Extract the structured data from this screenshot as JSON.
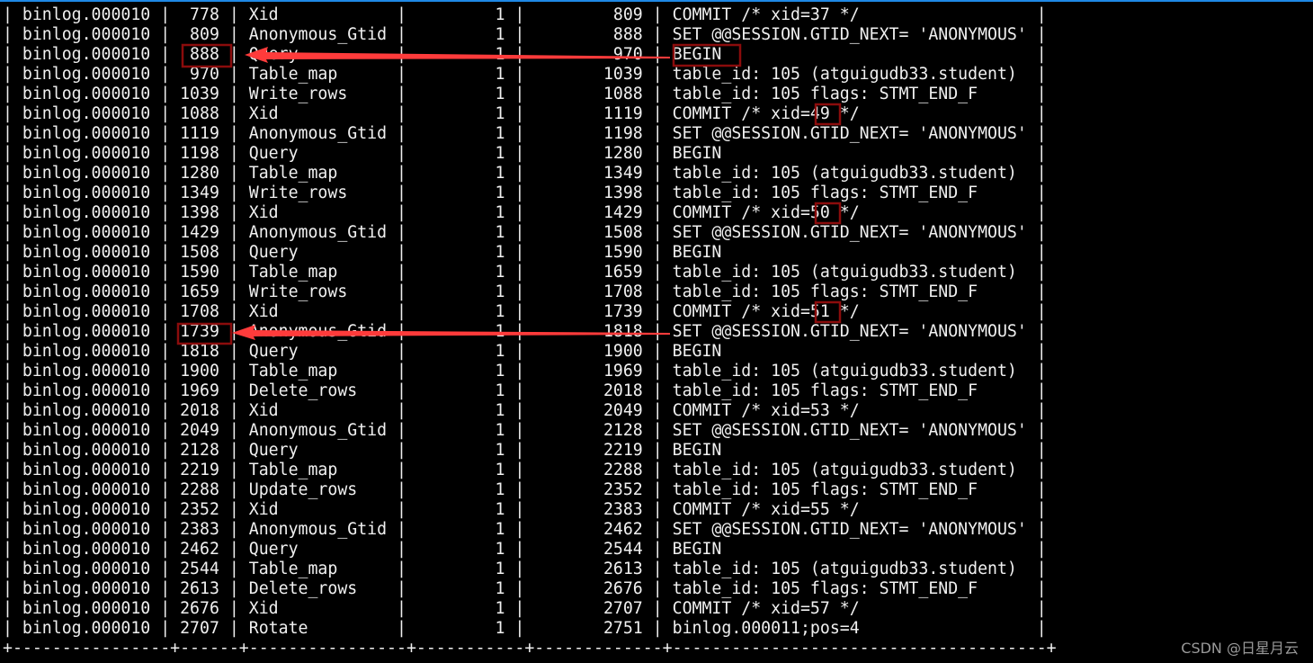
{
  "colors": {
    "accent_bar": "#1e88e5",
    "text": "#f0f0f0",
    "arrow": "#ff3b3b",
    "box": "#8b0c0c"
  },
  "rows": [
    [
      "binlog.000010",
      "778",
      "Xid",
      "1",
      "809",
      "COMMIT /* xid=37 */"
    ],
    [
      "binlog.000010",
      "809",
      "Anonymous_Gtid",
      "1",
      "888",
      "SET @@SESSION.GTID_NEXT= 'ANONYMOUS'"
    ],
    [
      "binlog.000010",
      "888",
      "Query",
      "1",
      "970",
      "BEGIN"
    ],
    [
      "binlog.000010",
      "970",
      "Table_map",
      "1",
      "1039",
      "table_id: 105 (atguigudb33.student)"
    ],
    [
      "binlog.000010",
      "1039",
      "Write_rows",
      "1",
      "1088",
      "table_id: 105 flags: STMT_END_F"
    ],
    [
      "binlog.000010",
      "1088",
      "Xid",
      "1",
      "1119",
      "COMMIT /* xid=49 */"
    ],
    [
      "binlog.000010",
      "1119",
      "Anonymous_Gtid",
      "1",
      "1198",
      "SET @@SESSION.GTID_NEXT= 'ANONYMOUS'"
    ],
    [
      "binlog.000010",
      "1198",
      "Query",
      "1",
      "1280",
      "BEGIN"
    ],
    [
      "binlog.000010",
      "1280",
      "Table_map",
      "1",
      "1349",
      "table_id: 105 (atguigudb33.student)"
    ],
    [
      "binlog.000010",
      "1349",
      "Write_rows",
      "1",
      "1398",
      "table_id: 105 flags: STMT_END_F"
    ],
    [
      "binlog.000010",
      "1398",
      "Xid",
      "1",
      "1429",
      "COMMIT /* xid=50 */"
    ],
    [
      "binlog.000010",
      "1429",
      "Anonymous_Gtid",
      "1",
      "1508",
      "SET @@SESSION.GTID_NEXT= 'ANONYMOUS'"
    ],
    [
      "binlog.000010",
      "1508",
      "Query",
      "1",
      "1590",
      "BEGIN"
    ],
    [
      "binlog.000010",
      "1590",
      "Table_map",
      "1",
      "1659",
      "table_id: 105 (atguigudb33.student)"
    ],
    [
      "binlog.000010",
      "1659",
      "Write_rows",
      "1",
      "1708",
      "table_id: 105 flags: STMT_END_F"
    ],
    [
      "binlog.000010",
      "1708",
      "Xid",
      "1",
      "1739",
      "COMMIT /* xid=51 */"
    ],
    [
      "binlog.000010",
      "1739",
      "Anonymous_Gtid",
      "1",
      "1818",
      "SET @@SESSION.GTID_NEXT= 'ANONYMOUS'"
    ],
    [
      "binlog.000010",
      "1818",
      "Query",
      "1",
      "1900",
      "BEGIN"
    ],
    [
      "binlog.000010",
      "1900",
      "Table_map",
      "1",
      "1969",
      "table_id: 105 (atguigudb33.student)"
    ],
    [
      "binlog.000010",
      "1969",
      "Delete_rows",
      "1",
      "2018",
      "table_id: 105 flags: STMT_END_F"
    ],
    [
      "binlog.000010",
      "2018",
      "Xid",
      "1",
      "2049",
      "COMMIT /* xid=53 */"
    ],
    [
      "binlog.000010",
      "2049",
      "Anonymous_Gtid",
      "1",
      "2128",
      "SET @@SESSION.GTID_NEXT= 'ANONYMOUS'"
    ],
    [
      "binlog.000010",
      "2128",
      "Query",
      "1",
      "2219",
      "BEGIN"
    ],
    [
      "binlog.000010",
      "2219",
      "Table_map",
      "1",
      "2288",
      "table_id: 105 (atguigudb33.student)"
    ],
    [
      "binlog.000010",
      "2288",
      "Update_rows",
      "1",
      "2352",
      "table_id: 105 flags: STMT_END_F"
    ],
    [
      "binlog.000010",
      "2352",
      "Xid",
      "1",
      "2383",
      "COMMIT /* xid=55 */"
    ],
    [
      "binlog.000010",
      "2383",
      "Anonymous_Gtid",
      "1",
      "2462",
      "SET @@SESSION.GTID_NEXT= 'ANONYMOUS'"
    ],
    [
      "binlog.000010",
      "2462",
      "Query",
      "1",
      "2544",
      "BEGIN"
    ],
    [
      "binlog.000010",
      "2544",
      "Table_map",
      "1",
      "2613",
      "table_id: 105 (atguigudb33.student)"
    ],
    [
      "binlog.000010",
      "2613",
      "Delete_rows",
      "1",
      "2676",
      "table_id: 105 flags: STMT_END_F"
    ],
    [
      "binlog.000010",
      "2676",
      "Xid",
      "1",
      "2707",
      "COMMIT /* xid=57 */"
    ],
    [
      "binlog.000010",
      "2707",
      "Rotate",
      "1",
      "2751",
      "binlog.000011;pos=4"
    ]
  ],
  "border": "+----------------+------+----------------+-----------+-------------+--------------------------------------+",
  "watermark": "CSDN @日星月云"
}
